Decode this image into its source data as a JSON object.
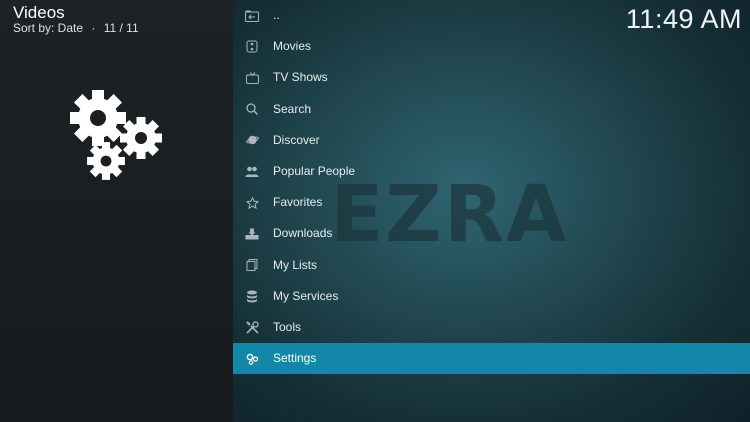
{
  "header": {
    "title": "Videos",
    "sort_label": "Sort by: Date",
    "separator": "·",
    "position": "11 / 11"
  },
  "clock": "11:49 AM",
  "watermark": "EZRA",
  "menu": {
    "items": [
      {
        "label": "..",
        "icon": "folder-up-icon"
      },
      {
        "label": "Movies",
        "icon": "film-icon"
      },
      {
        "label": "TV Shows",
        "icon": "tv-icon"
      },
      {
        "label": "Search",
        "icon": "search-icon"
      },
      {
        "label": "Discover",
        "icon": "planet-icon"
      },
      {
        "label": "Popular People",
        "icon": "people-icon"
      },
      {
        "label": "Favorites",
        "icon": "star-icon"
      },
      {
        "label": "Downloads",
        "icon": "download-icon"
      },
      {
        "label": "My Lists",
        "icon": "lists-icon"
      },
      {
        "label": "My Services",
        "icon": "database-icon"
      },
      {
        "label": "Tools",
        "icon": "tools-icon"
      },
      {
        "label": "Settings",
        "icon": "gears-icon"
      }
    ],
    "selected_index": 11
  },
  "colors": {
    "highlight": "#1287a8",
    "left_pane": "#1b1f22",
    "right_pane": "#2f6572"
  }
}
